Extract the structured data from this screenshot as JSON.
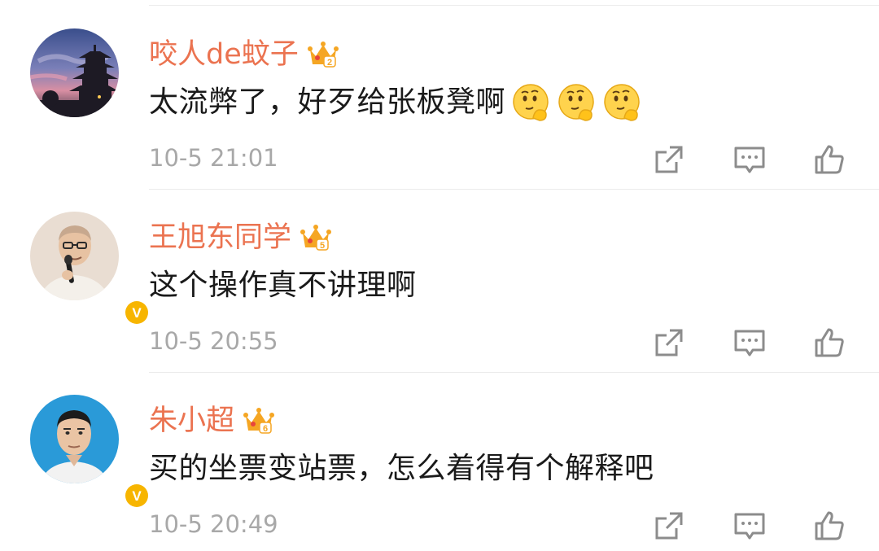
{
  "comments": [
    {
      "username": "咬人de蚊子",
      "crown_level": "2",
      "text": "太流弊了，好歹给张板凳啊",
      "emojis": [
        "thinking-emoji",
        "thinking-emoji",
        "thinking-emoji"
      ],
      "timestamp": "10-5 21:01",
      "verified": false,
      "avatar": "pagoda-sunset-avatar"
    },
    {
      "username": "王旭东同学",
      "crown_level": "5",
      "text": "这个操作真不讲理啊",
      "emojis": [],
      "timestamp": "10-5 20:55",
      "verified": true,
      "verified_glyph": "V",
      "avatar": "man-with-microphone-avatar"
    },
    {
      "username": "朱小超",
      "crown_level": "6",
      "text": "买的坐票变站票，怎么着得有个解释吧",
      "emojis": [],
      "timestamp": "10-5 20:49",
      "verified": true,
      "verified_glyph": "V",
      "avatar": "man-blue-background-avatar"
    }
  ],
  "icons": {
    "share": "share-icon",
    "comment": "comment-icon",
    "like": "thumbs-up-icon"
  },
  "colors": {
    "username": "#eb7350",
    "text": "#1a1a1a",
    "timestamp": "#a8a8a8",
    "divider": "#ebebeb",
    "crown": "#f5a623",
    "verified_badge": "#f7b500",
    "action_icon": "#8c8c8c"
  }
}
